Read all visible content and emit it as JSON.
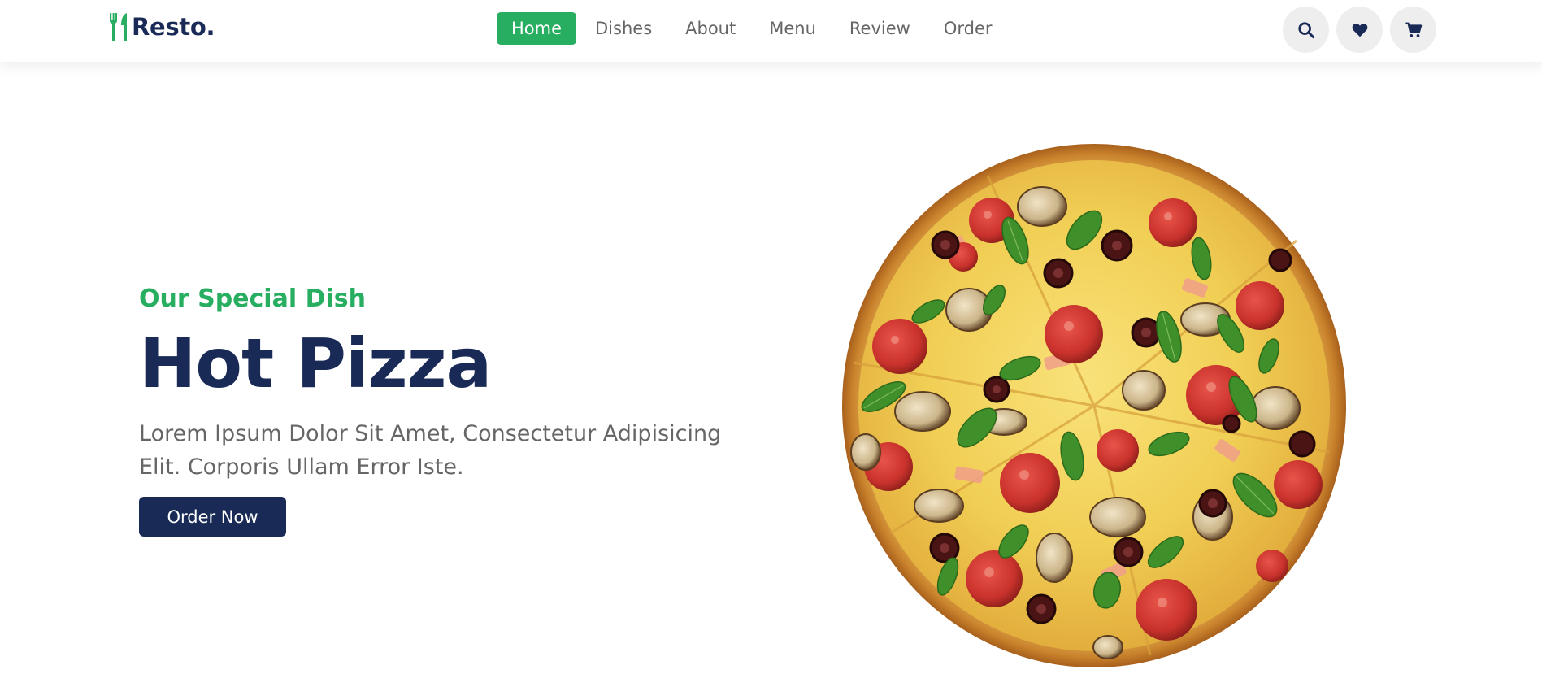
{
  "brand": {
    "name": "Resto.",
    "icon": "utensils-icon",
    "color": "#27ae60",
    "dark": "#192a56"
  },
  "nav": {
    "items": [
      {
        "label": "Home",
        "active": true
      },
      {
        "label": "Dishes",
        "active": false
      },
      {
        "label": "About",
        "active": false
      },
      {
        "label": "Menu",
        "active": false
      },
      {
        "label": "Review",
        "active": false
      },
      {
        "label": "Order",
        "active": false
      }
    ]
  },
  "header_icons": [
    "search-icon",
    "heart-icon",
    "cart-icon"
  ],
  "hero": {
    "subtitle": "Our Special Dish",
    "title": "Hot Pizza",
    "description": "Lorem Ipsum Dolor Sit Amet, Consectetur Adipisicing Elit. Corporis Ullam Error Iste.",
    "button_label": "Order Now",
    "image": "pizza-image"
  }
}
